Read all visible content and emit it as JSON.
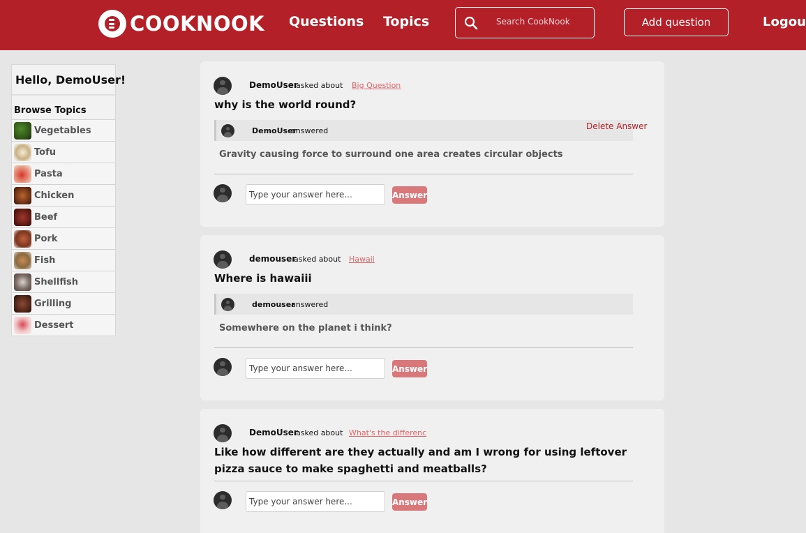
{
  "brand": {
    "name": "COOKNOOK"
  },
  "nav": {
    "questions": "Questions",
    "topics": "Topics",
    "search_placeholder": "Search CookNook",
    "add_question": "Add question",
    "logout": "Logout"
  },
  "sidebar": {
    "greeting": "Hello, DemoUser!",
    "browse_title": "Browse Topics",
    "topics": [
      {
        "label": "Vegetables"
      },
      {
        "label": "Tofu"
      },
      {
        "label": "Pasta"
      },
      {
        "label": "Chicken"
      },
      {
        "label": "Beef"
      },
      {
        "label": "Pork"
      },
      {
        "label": "Fish"
      },
      {
        "label": "Shellfish"
      },
      {
        "label": "Grilling"
      },
      {
        "label": "Dessert"
      }
    ]
  },
  "questions": [
    {
      "asker": "DemoUser",
      "asked_about": "asked about",
      "topic": "Big Question",
      "title": "why is the world round?",
      "answer": {
        "author": "DemoUser",
        "answered": "answered",
        "delete": "Delete Answer",
        "text": "Gravity causing force to surround one area creates circular objects"
      },
      "input_placeholder": "Type your answer here...",
      "answer_button": "Answer"
    },
    {
      "asker": "demouser",
      "asked_about": "asked about",
      "topic": "Hawaii",
      "title": "Where is hawaiii",
      "answer": {
        "author": "demouser",
        "answered": "answered",
        "text": "Somewhere on the planet i think?"
      },
      "input_placeholder": "Type your answer here...",
      "answer_button": "Answer"
    },
    {
      "asker": "DemoUser",
      "asked_about": "asked about",
      "topic": "What's the differenc",
      "title": "Like how different are they actually and am I wrong for using leftover pizza sauce to make spaghetti and meatballs?",
      "input_placeholder": "Type your answer here...",
      "answer_button": "Answer"
    }
  ],
  "colors": {
    "brand_red": "#b32028",
    "link_pink": "#e06468",
    "answer_button": "#d9787b"
  }
}
